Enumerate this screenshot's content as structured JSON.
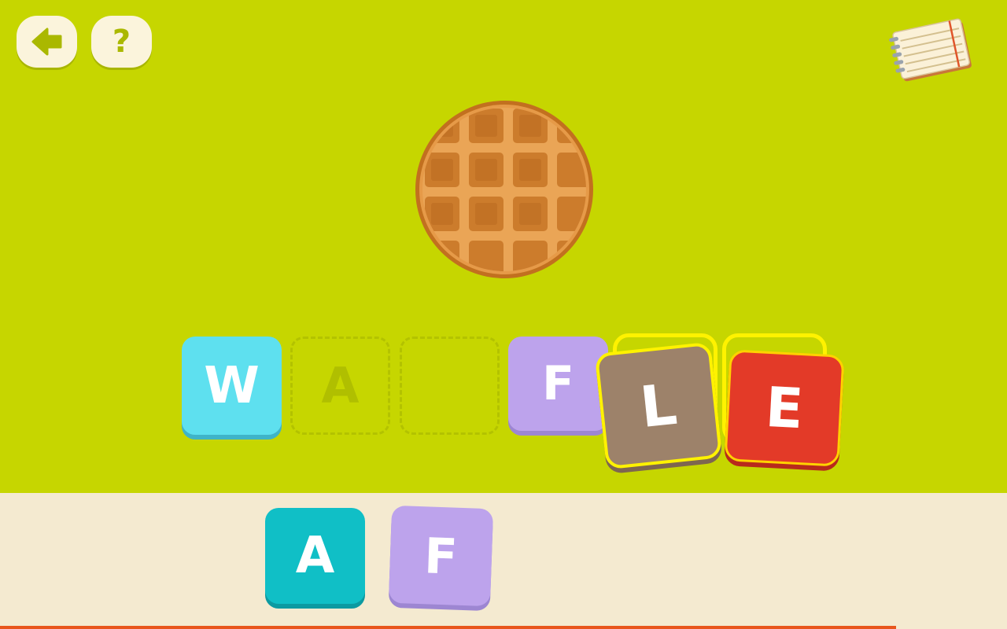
{
  "toolbar": {
    "back_icon": "arrow-left-icon",
    "help_label": "?",
    "notebook_icon": "notebook-icon"
  },
  "puzzle": {
    "picture": "waffle-icon",
    "slots": [
      {
        "letter": "W",
        "state": "filled",
        "color": "#5ee0ef"
      },
      {
        "letter": "A",
        "state": "empty-hint"
      },
      {
        "letter": "",
        "state": "empty"
      },
      {
        "letter": "F",
        "state": "filled",
        "color": "#bda3ec"
      },
      {
        "letter": "L",
        "state": "dropped",
        "color": "#9d826a"
      },
      {
        "letter": "E",
        "state": "dropped",
        "color": "#e33a28"
      }
    ]
  },
  "tray": {
    "tiles": [
      {
        "letter": "A",
        "color": "#10bfc6"
      },
      {
        "letter": "F",
        "color": "#bda3ec"
      }
    ]
  },
  "progress": {
    "fraction": 0.89,
    "color": "#e8561c"
  }
}
